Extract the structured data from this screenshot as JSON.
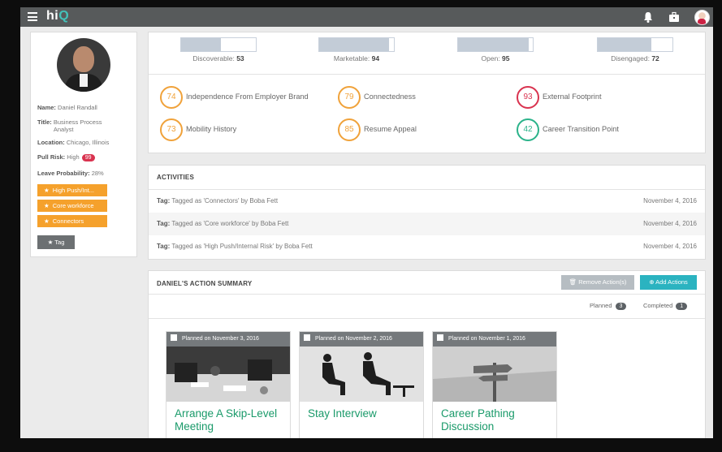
{
  "app": {
    "logo_main": "hi",
    "logo_accent": "Q"
  },
  "icons": [
    "menu-icon",
    "bell-icon",
    "briefcase-icon",
    "user-avatar-icon"
  ],
  "profile": {
    "name_label": "Name:",
    "name": "Daniel Randall",
    "title_label": "Title:",
    "title": "Business Process Analyst",
    "location_label": "Location:",
    "location": "Chicago, Illinois",
    "pull_risk_label": "Pull Risk:",
    "pull_risk": "High",
    "pull_risk_score": "99",
    "leave_label": "Leave Probability:",
    "leave_probability": "28%",
    "tags": [
      "High Push/Int...",
      "Core workforce",
      "Connectors"
    ],
    "tag_button": "Tag"
  },
  "stats": [
    {
      "label": "Discoverable:",
      "value": "53",
      "fill": 0.53
    },
    {
      "label": "Marketable:",
      "value": "94",
      "fill": 0.94
    },
    {
      "label": "Open:",
      "value": "95",
      "fill": 0.95
    },
    {
      "label": "Disengaged:",
      "value": "72",
      "fill": 0.72
    }
  ],
  "metrics": [
    {
      "score": "74",
      "label": "Independence From Employer Brand",
      "color": "#f0a23a"
    },
    {
      "score": "79",
      "label": "Connectedness",
      "color": "#f0a23a"
    },
    {
      "score": "93",
      "label": "External Footprint",
      "color": "#d9334f"
    },
    {
      "score": "73",
      "label": "Mobility History",
      "color": "#f0a23a"
    },
    {
      "score": "85",
      "label": "Resume Appeal",
      "color": "#f0a23a"
    },
    {
      "score": "42",
      "label": "Career Transition Point",
      "color": "#2bb38a"
    }
  ],
  "activities": {
    "title": "ACTIVITIES",
    "rows": [
      {
        "prefix": "Tag:",
        "text": "Tagged as 'Connectors' by Boba Fett",
        "date": "November 4, 2016"
      },
      {
        "prefix": "Tag:",
        "text": "Tagged as 'Core workforce' by Boba Fett",
        "date": "November 4, 2016"
      },
      {
        "prefix": "Tag:",
        "text": "Tagged as 'High Push/Internal Risk' by Boba Fett",
        "date": "November 4, 2016"
      }
    ]
  },
  "summary": {
    "title": "DANIEL'S ACTION SUMMARY",
    "remove_label": "Remove Action(s)",
    "add_label": "Add Actions",
    "planned_label": "Planned",
    "planned_count": "3",
    "completed_label": "Completed",
    "completed_count": "1",
    "cards": [
      {
        "planned": "Planned on November 3, 2016",
        "title": "Arrange A Skip-Level Meeting"
      },
      {
        "planned": "Planned on November 2, 2016",
        "title": "Stay Interview"
      },
      {
        "planned": "Planned on November 1, 2016",
        "title": "Career Pathing Discussion"
      }
    ]
  }
}
